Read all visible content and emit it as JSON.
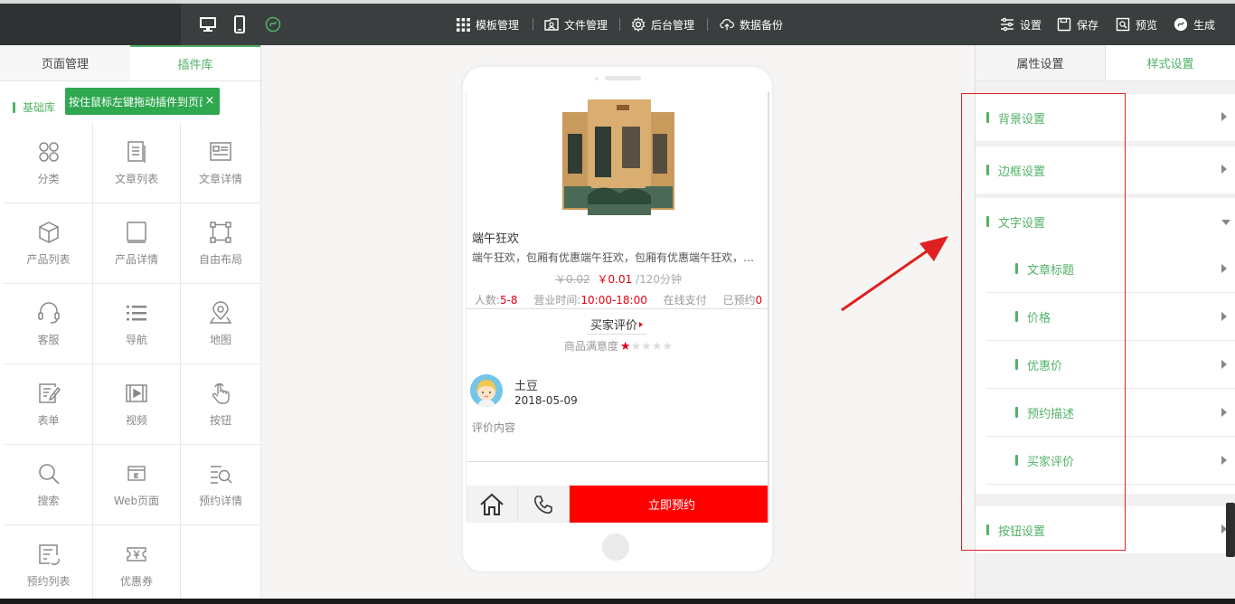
{
  "topbar": {
    "nav": {
      "template": "模板管理",
      "files": "文件管理",
      "backend": "后台管理",
      "backup": "数据备份"
    },
    "actions": {
      "settings": "设置",
      "save": "保存",
      "preview": "预览",
      "generate": "生成"
    }
  },
  "left_panel": {
    "tabs": [
      "页面管理",
      "插件库"
    ],
    "active_tab": 1,
    "library_label": "基础库",
    "tooltip": "按住鼠标左键拖动插件到页面",
    "plugins": [
      {
        "label": "分类",
        "icon": "category-icon"
      },
      {
        "label": "文章列表",
        "icon": "article-list-icon"
      },
      {
        "label": "文章详情",
        "icon": "article-detail-icon"
      },
      {
        "label": "产品列表",
        "icon": "product-list-icon"
      },
      {
        "label": "产品详情",
        "icon": "product-detail-icon"
      },
      {
        "label": "自由布局",
        "icon": "free-layout-icon"
      },
      {
        "label": "客服",
        "icon": "headset-icon"
      },
      {
        "label": "导航",
        "icon": "navigation-icon"
      },
      {
        "label": "地图",
        "icon": "map-pin-icon"
      },
      {
        "label": "表单",
        "icon": "form-icon"
      },
      {
        "label": "视频",
        "icon": "video-icon"
      },
      {
        "label": "按钮",
        "icon": "pointer-hand-icon"
      },
      {
        "label": "搜索",
        "icon": "search-icon"
      },
      {
        "label": "Web页面",
        "icon": "web-page-icon"
      },
      {
        "label": "预约详情",
        "icon": "booking-detail-icon"
      },
      {
        "label": "预约列表",
        "icon": "booking-list-icon"
      },
      {
        "label": "优惠券",
        "icon": "coupon-icon"
      }
    ]
  },
  "phone": {
    "product_title": "端午狂欢",
    "product_desc": "端午狂欢，包厢有优惠端午狂欢，包厢有优惠端午狂欢，包厢有优惠",
    "price_old": "￥0.02",
    "price_new": "￥0.01",
    "duration": "/120分钟",
    "info": {
      "people_label": "人数:",
      "people_value": "5-8",
      "hours_label": "营业时间:",
      "hours_value": "10:00-18:00",
      "payment": "在线支付",
      "booked_label": "已预约",
      "booked_value": "0"
    },
    "review_button": "买家评价",
    "satisfaction_label": "商品满意度",
    "rating": 1,
    "rating_max": 5,
    "reviewer_name": "土豆",
    "review_date": "2018-05-09",
    "review_content": "评价内容",
    "book_button": "立即预约"
  },
  "right_panel": {
    "tabs": [
      "属性设置",
      "样式设置"
    ],
    "active_tab": 1,
    "sections": {
      "background": "背景设置",
      "border": "边框设置",
      "text": "文字设置",
      "button": "按钮设置"
    },
    "text_subsections": [
      "文章标题",
      "价格",
      "优惠价",
      "预约描述",
      "买家评价"
    ]
  },
  "colors": {
    "accent_green": "#52b267",
    "topbar": "#3b3e3f",
    "price_red": "#e60012",
    "book_red": "#ff0000",
    "annotation_red": "#e02020"
  }
}
